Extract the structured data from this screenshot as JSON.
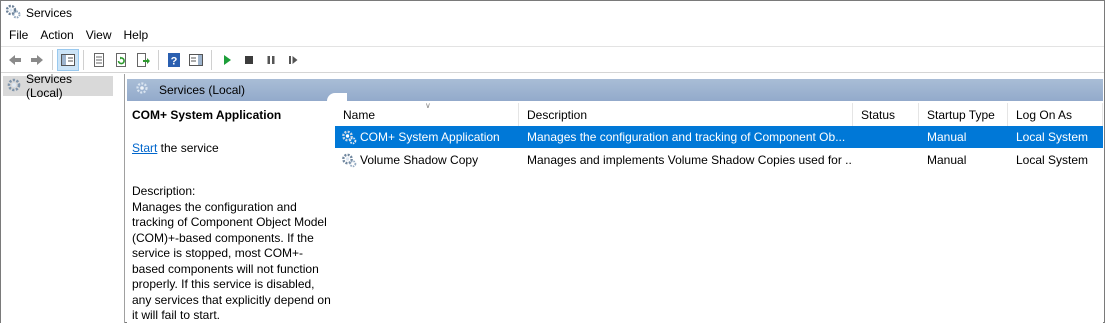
{
  "window": {
    "title": "Services"
  },
  "menu": [
    "File",
    "Action",
    "View",
    "Help"
  ],
  "toolbar": {
    "buttons": [
      {
        "name": "back-icon"
      },
      {
        "name": "forward-icon"
      },
      {
        "name": "show-hide-console-tree-icon"
      },
      {
        "name": "properties-icon"
      },
      {
        "name": "refresh-icon"
      },
      {
        "name": "export-list-icon"
      },
      {
        "name": "help-icon"
      },
      {
        "name": "show-action-pane-icon"
      },
      {
        "name": "start-service-icon"
      },
      {
        "name": "stop-service-icon"
      },
      {
        "name": "pause-service-icon"
      },
      {
        "name": "resume-service-icon"
      }
    ]
  },
  "tree": {
    "items": [
      {
        "label": "Services (Local)"
      }
    ]
  },
  "content_header": {
    "label": "Services (Local)"
  },
  "details": {
    "title": "COM+ System Application",
    "start_link": "Start",
    "start_suffix": " the service",
    "description_label": "Description:",
    "description": "Manages the configuration and tracking of Component Object Model (COM)+-based components. If the service is stopped, most COM+-based components will not function properly. If this service is disabled, any services that explicitly depend on it will fail to start."
  },
  "table": {
    "columns": [
      "Name",
      "Description",
      "Status",
      "Startup Type",
      "Log On As"
    ],
    "rows": [
      {
        "name": "COM+ System Application",
        "description": "Manages the configuration and tracking of Component Ob...",
        "status": "",
        "startup": "Manual",
        "logon": "Local System",
        "selected": true
      },
      {
        "name": "Volume Shadow Copy",
        "description": "Manages and implements Volume Shadow Copies used for ...",
        "status": "",
        "startup": "Manual",
        "logon": "Local System",
        "selected": false
      }
    ]
  },
  "colors": {
    "selection": "#0078d7",
    "header_band": "#a9bdd6",
    "link": "#0066cc"
  }
}
